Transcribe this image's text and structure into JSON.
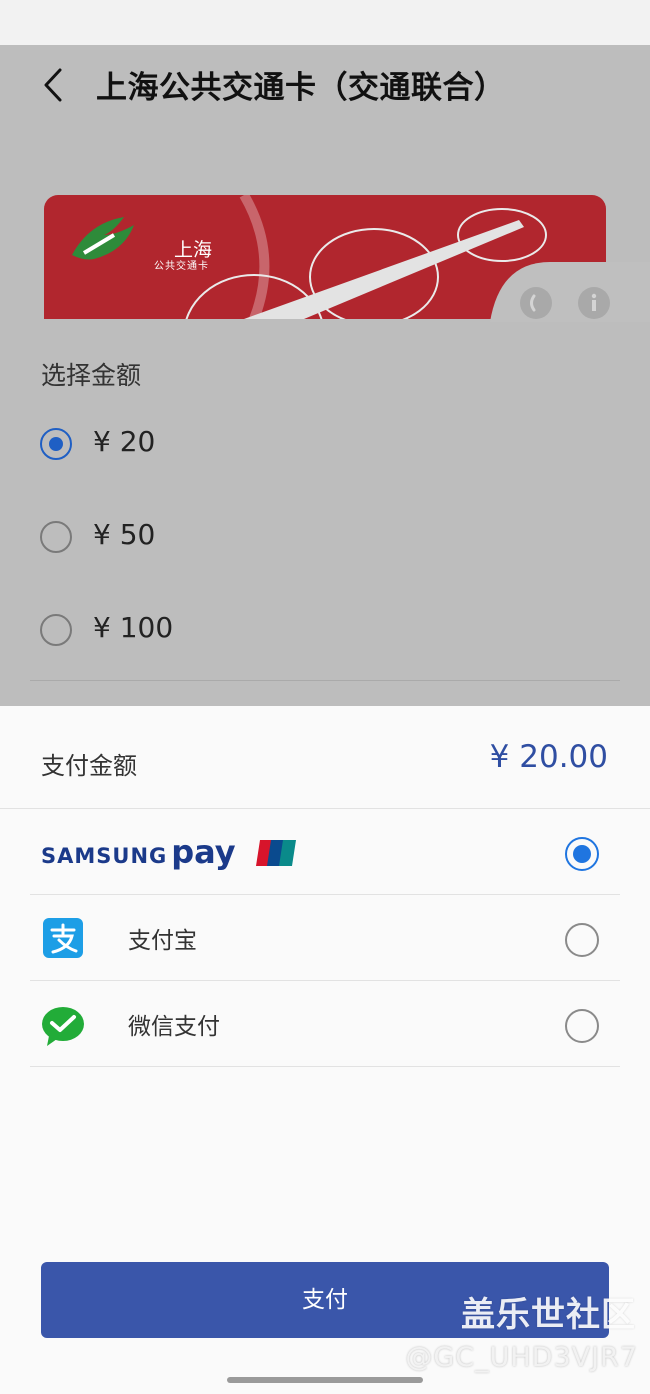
{
  "header": {
    "title": "上海公共交通卡（交通联合）"
  },
  "card": {
    "logo_text": "上海",
    "logo_subtext": "公共交通卡",
    "card_color": "#b1262e"
  },
  "amount_section": {
    "label": "选择金额",
    "options": [
      {
        "label": "¥ 20",
        "selected": true
      },
      {
        "label": "¥ 50",
        "selected": false
      },
      {
        "label": "¥ 100",
        "selected": false
      }
    ]
  },
  "payment": {
    "amount_label": "支付金额",
    "amount_value": "¥ 20.00",
    "methods": [
      {
        "brand_text_1": "SAMSUNG",
        "brand_text_2": "pay",
        "icon": "unionpay-icon",
        "selected": true
      },
      {
        "name": "支付宝",
        "icon": "alipay-icon",
        "selected": false
      },
      {
        "name": "微信支付",
        "icon": "wechat-pay-icon",
        "selected": false
      }
    ],
    "pay_button": "支付"
  },
  "watermark": {
    "site": "盖乐世社区",
    "user": "@GC_UHD3VJR7"
  },
  "colors": {
    "accent": "#3a56aa",
    "radio_selected": "#1f75e0"
  }
}
